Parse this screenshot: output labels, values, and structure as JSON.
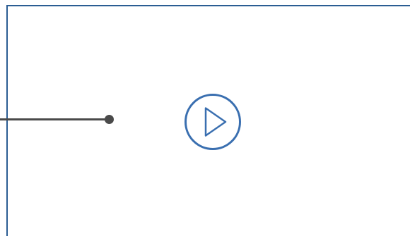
{
  "colors": {
    "frame_border": "#2b5d93",
    "play_icon": "#3a6fb0",
    "connector": "#4a4a4a",
    "background": "#ffffff"
  },
  "icons": {
    "play": "play-circle-icon",
    "connector_end": "dot"
  }
}
